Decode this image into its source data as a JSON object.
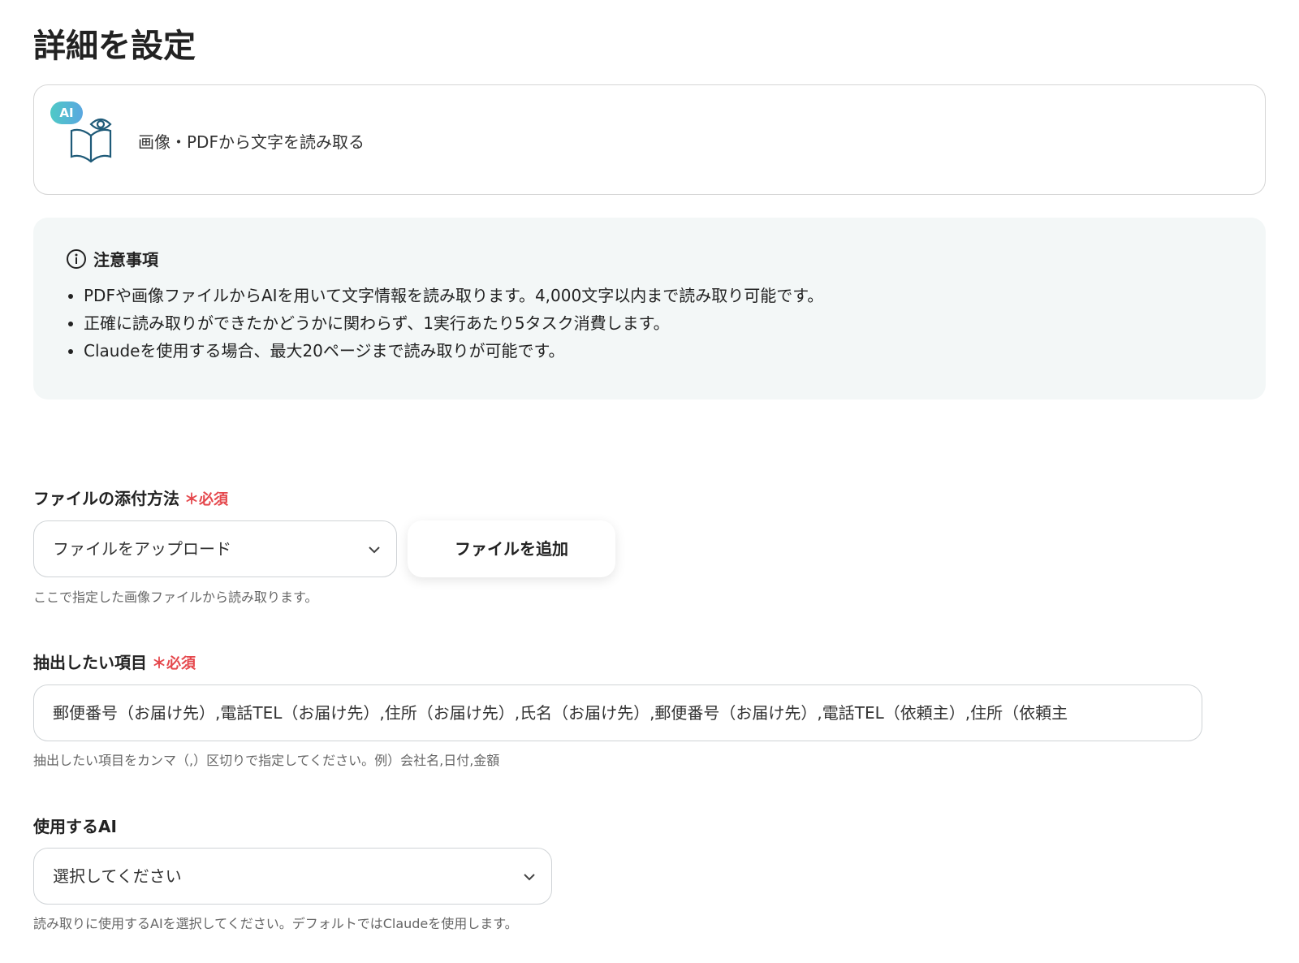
{
  "page": {
    "title": "詳細を設定"
  },
  "operation": {
    "badge": "AI",
    "label": "画像・PDFから文字を読み取る"
  },
  "notice": {
    "heading": "注意事項",
    "items": [
      "PDFや画像ファイルからAIを用いて文字情報を読み取ります。4,000文字以内まで読み取り可能です。",
      "正確に読み取りができたかどうかに関わらず、1実行あたり5タスク消費します。",
      "Claudeを使用する場合、最大20ページまで読み取りが可能です。"
    ]
  },
  "attach": {
    "label": "ファイルの添付方法",
    "required": "＊必須",
    "value": "ファイルをアップロード",
    "button": "ファイルを追加",
    "hint": "ここで指定した画像ファイルから読み取ります。"
  },
  "extract": {
    "label": "抽出したい項目",
    "required": "＊必須",
    "value": "郵便番号（お届け先）,電話TEL（お届け先）,住所（お届け先）,氏名（お届け先）,郵便番号（お届け先）,電話TEL（依頼主）,住所（依頼主",
    "hint": "抽出したい項目をカンマ（,）区切りで指定してください。例）会社名,日付,金額"
  },
  "ai": {
    "label": "使用するAI",
    "value": "選択してください",
    "hint": "読み取りに使用するAIを選択してください。デフォルトではClaudeを使用します。"
  }
}
